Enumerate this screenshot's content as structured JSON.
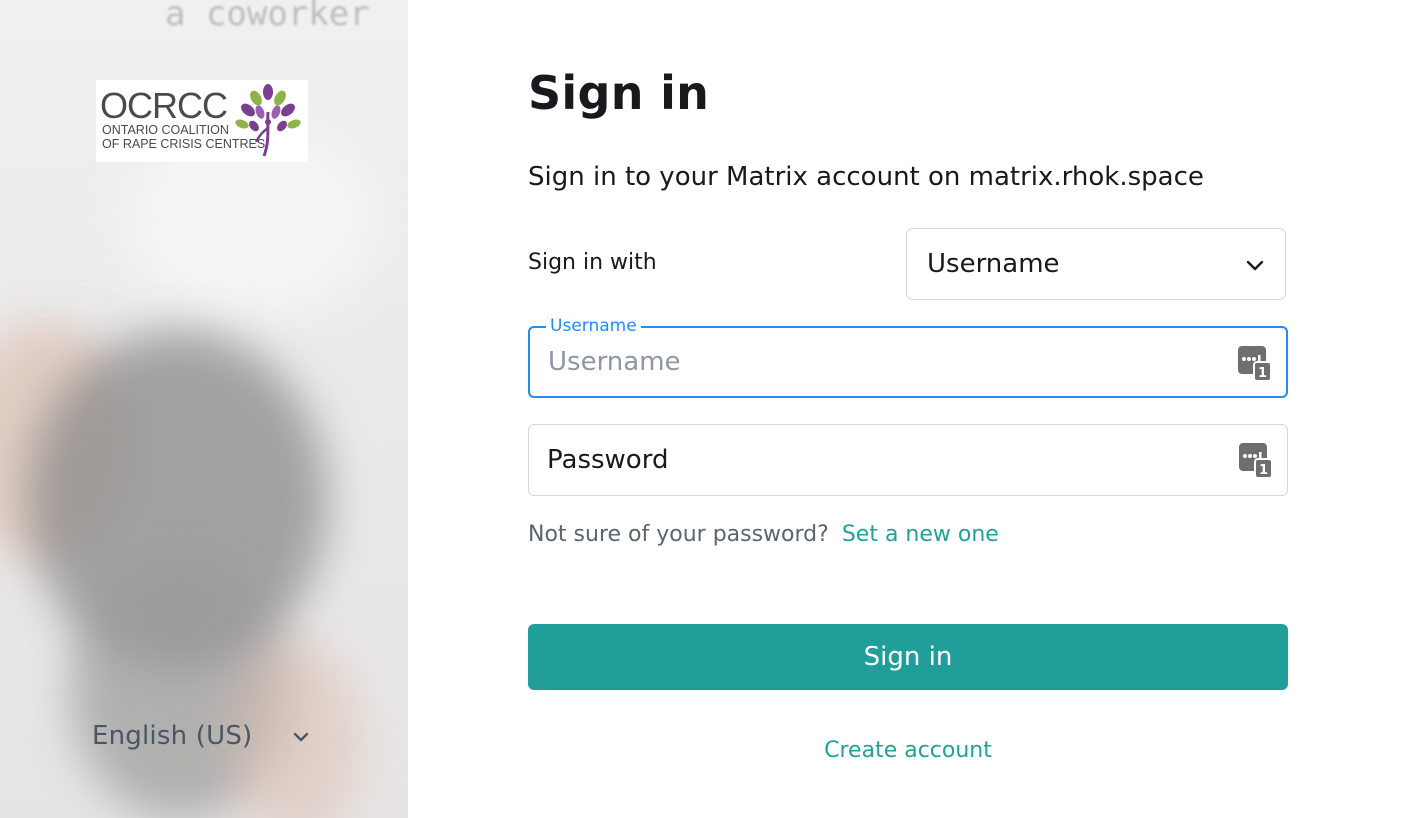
{
  "background": {
    "blurred_text": "a coworker"
  },
  "branding": {
    "logo_text": "OCRCC",
    "logo_line1": "ONTARIO COALITION",
    "logo_line2": "OF RAPE CRISIS CENTRES"
  },
  "language": {
    "selected": "English (US)",
    "icon": "chevron-down-icon"
  },
  "auth": {
    "title": "Sign in",
    "subtitle": "Sign in to your Matrix account on matrix.rhok.space",
    "sign_in_with_label": "Sign in with",
    "login_type": {
      "selected": "Username",
      "icon": "chevron-down-icon"
    },
    "username_field": {
      "label": "Username",
      "placeholder": "Username",
      "value": "",
      "focused": true,
      "icon": "password-manager-icon"
    },
    "password_field": {
      "placeholder": "Password",
      "value": "",
      "icon": "password-manager-icon"
    },
    "forgot_prompt": "Not sure of your password?",
    "forgot_link": "Set a new one",
    "submit_label": "Sign in",
    "create_account_label": "Create account"
  },
  "colors": {
    "accent": "#219e9a",
    "focus": "#238cf5",
    "text": "#17191c",
    "muted": "#5c6470",
    "border": "#d5d7da"
  }
}
